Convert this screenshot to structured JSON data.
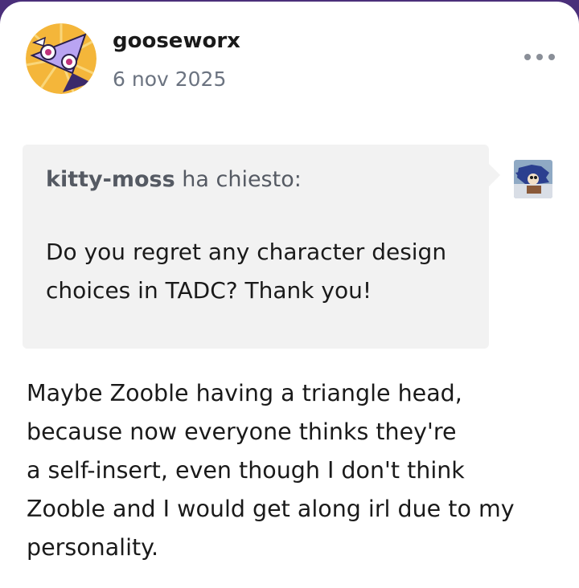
{
  "post": {
    "author": {
      "username": "gooseworx",
      "avatar_icon": "zooble-avatar-icon"
    },
    "date": "6 nov 2025",
    "more_icon": "more-horizontal-icon"
  },
  "ask": {
    "asker": "kitty-moss",
    "asked_text": "ha chiesto:",
    "question_lines": [
      "Do you regret any character design",
      "choices in TADC? Thank you!"
    ],
    "asker_avatar_icon": "sonic-avatar-icon"
  },
  "answer": {
    "lines": [
      "Maybe Zooble having a triangle head,",
      "because now everyone thinks they're",
      "a self-insert, even though I don't think",
      "Zooble and I would get along irl due to my",
      "personality."
    ]
  },
  "colors": {
    "background": "#4a2f7a",
    "card": "#ffffff",
    "bubble": "#f2f2f2",
    "muted_text": "#6b7380"
  }
}
